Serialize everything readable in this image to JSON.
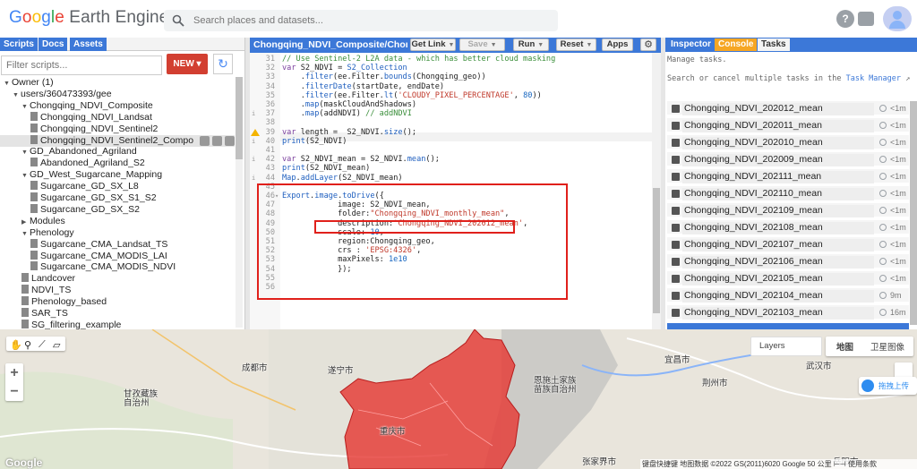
{
  "header": {
    "logo_google": [
      "G",
      "o",
      "o",
      "g",
      "l",
      "e"
    ],
    "logo_product": "Earth Engine",
    "search_placeholder": "Search places and datasets...",
    "help_icon": "?"
  },
  "left_panel": {
    "tabs": [
      "Scripts",
      "Docs",
      "Assets"
    ],
    "filter_placeholder": "Filter scripts...",
    "new_label": "NEW",
    "tree": [
      {
        "label": "Owner (1)",
        "level": 0,
        "type": "folder",
        "open": true
      },
      {
        "label": "users/360473393/gee",
        "level": 1,
        "type": "folder",
        "open": true
      },
      {
        "label": "Chongqing_NDVI_Composite",
        "level": 2,
        "type": "folder",
        "open": true
      },
      {
        "label": "Chongqing_NDVI_Landsat",
        "level": 3,
        "type": "file"
      },
      {
        "label": "Chongqing_NDVI_Sentinel2",
        "level": 3,
        "type": "file"
      },
      {
        "label": "Chongqing_NDVI_Sentinel2_Compo",
        "level": 3,
        "type": "file",
        "selected": true
      },
      {
        "label": "GD_Abandoned_Agriland",
        "level": 2,
        "type": "folder",
        "open": true
      },
      {
        "label": "Abandoned_Agriland_S2",
        "level": 3,
        "type": "file"
      },
      {
        "label": "GD_West_Sugarcane_Mapping",
        "level": 2,
        "type": "folder",
        "open": true
      },
      {
        "label": "Sugarcane_GD_SX_L8",
        "level": 3,
        "type": "file"
      },
      {
        "label": "Sugarcane_GD_SX_S1_S2",
        "level": 3,
        "type": "file"
      },
      {
        "label": "Sugarcane_GD_SX_S2",
        "level": 3,
        "type": "file"
      },
      {
        "label": "Modules",
        "level": 2,
        "type": "folder",
        "open": false
      },
      {
        "label": "Phenology",
        "level": 2,
        "type": "folder",
        "open": true
      },
      {
        "label": "Sugarcane_CMA_Landsat_TS",
        "level": 3,
        "type": "file"
      },
      {
        "label": "Sugarcane_CMA_MODIS_LAI",
        "level": 3,
        "type": "file"
      },
      {
        "label": "Sugarcane_CMA_MODIS_NDVI",
        "level": 3,
        "type": "file"
      },
      {
        "label": "Landcover",
        "level": 2,
        "type": "file"
      },
      {
        "label": "NDVI_TS",
        "level": 2,
        "type": "file"
      },
      {
        "label": "Phenology_based",
        "level": 2,
        "type": "file"
      },
      {
        "label": "SAR_TS",
        "level": 2,
        "type": "file"
      },
      {
        "label": "SG_filtering_example",
        "level": 2,
        "type": "file"
      }
    ]
  },
  "editor": {
    "title": "Chongqing_NDVI_Composite/Chongqi...",
    "buttons": {
      "get_link": "Get Link",
      "save": "Save",
      "run": "Run",
      "reset": "Reset",
      "apps": "Apps"
    },
    "lines": [
      {
        "n": "31",
        "html": "<span class=\"cmt\">// Use Sentinel-2 L2A data - which has better cloud masking</span>"
      },
      {
        "n": "32",
        "html": "<span class=\"kw\">var</span> S2_NDVI = <span class=\"fn\">S2_Collection</span>"
      },
      {
        "n": "33",
        "html": "    .<span class=\"fn\">filter</span>(ee.Filter.<span class=\"fn\">bounds</span>(Chongqing_geo))"
      },
      {
        "n": "34",
        "html": "    .<span class=\"fn\">filterDate</span>(startDate, endDate)"
      },
      {
        "n": "35",
        "html": "    .<span class=\"fn\">filter</span>(ee.Filter.<span class=\"fn\">lt</span>(<span class=\"str\">'CLOUDY_PIXEL_PERCENTAGE'</span>, <span class=\"num\">80</span>))"
      },
      {
        "n": "36",
        "html": "    .<span class=\"fn\">map</span>(maskCloudAndShadows)"
      },
      {
        "n": "37",
        "html": "    .<span class=\"fn\">map</span>(addNDVI) <span class=\"cmt\">// addNDVI</span>"
      },
      {
        "n": "38",
        "html": ""
      },
      {
        "n": "39",
        "html": "<span class=\"kw\">var</span> length =  S2_NDVI.<span class=\"fn\">size</span>();"
      },
      {
        "n": "40",
        "html": "<span class=\"fn\">print</span>(S2_NDVI)"
      },
      {
        "n": "41",
        "html": ""
      },
      {
        "n": "42",
        "html": "<span class=\"kw\">var</span> S2_NDVI_mean = S2_NDVI.<span class=\"fn\">mean</span>();"
      },
      {
        "n": "43",
        "html": "<span class=\"fn\">print</span>(S2_NDVI_mean)"
      },
      {
        "n": "44",
        "html": "<span class=\"fn\">Map</span>.<span class=\"fn\">addLayer</span>(S2_NDVI_mean)"
      },
      {
        "n": "45",
        "html": ""
      },
      {
        "n": "46",
        "html": "<span class=\"fn\">Export</span>.<span class=\"fn\">image</span>.<span class=\"fn\">toDrive</span>({"
      },
      {
        "n": "47",
        "html": "            image: S2_NDVI_mean,"
      },
      {
        "n": "48",
        "html": "            folder:<span class=\"str\">\"Chongqing_NDVI_monthly_mean\"</span>,"
      },
      {
        "n": "49",
        "html": "            description:<span class=\"str\">'Chongqing_NDVI_202012_mean'</span>,"
      },
      {
        "n": "50",
        "html": "            scale: <span class=\"num\">10</span>,"
      },
      {
        "n": "51",
        "html": "            region:Chongqing_geo,"
      },
      {
        "n": "52",
        "html": "            crs : <span class=\"str\">'EPSG:4326'</span>,"
      },
      {
        "n": "53",
        "html": "            maxPixels: <span class=\"num\">1e10</span>"
      },
      {
        "n": "54",
        "html": "            });"
      },
      {
        "n": "55",
        "html": ""
      },
      {
        "n": "56",
        "html": ""
      }
    ]
  },
  "right_panel": {
    "tabs": [
      "Inspector",
      "Console",
      "Tasks"
    ],
    "manage_text": "Manage tasks.",
    "search_text": "Search or cancel multiple tasks in the",
    "task_manager_link": "Task Manager",
    "tasks": [
      {
        "name": "Chongqing_NDVI_202012_mean",
        "time": "<1m"
      },
      {
        "name": "Chongqing_NDVI_202011_mean",
        "time": "<1m"
      },
      {
        "name": "Chongqing_NDVI_202010_mean",
        "time": "<1m"
      },
      {
        "name": "Chongqing_NDVI_202009_mean",
        "time": "<1m"
      },
      {
        "name": "Chongqing_NDVI_202111_mean",
        "time": "<1m"
      },
      {
        "name": "Chongqing_NDVI_202110_mean",
        "time": "<1m"
      },
      {
        "name": "Chongqing_NDVI_202109_mean",
        "time": "<1m"
      },
      {
        "name": "Chongqing_NDVI_202108_mean",
        "time": "<1m"
      },
      {
        "name": "Chongqing_NDVI_202107_mean",
        "time": "<1m"
      },
      {
        "name": "Chongqing_NDVI_202106_mean",
        "time": "<1m"
      },
      {
        "name": "Chongqing_NDVI_202105_mean",
        "time": "<1m"
      },
      {
        "name": "Chongqing_NDVI_202104_mean",
        "time": "9m"
      },
      {
        "name": "Chongqing_NDVI_202103_mean",
        "time": "16m"
      }
    ]
  },
  "map": {
    "layers_label": "Layers",
    "map_type": "地图",
    "satellite_type": "卫星图像",
    "side_label": "拖拽上传",
    "google_logo": "Google",
    "attribution": "键盘快捷键   地图数据 ©2022 GS(2011)6020 Google   50 公里 ⊢⊣   使用条款",
    "cities": [
      {
        "label": "成都市"
      },
      {
        "label": "遂宁市"
      },
      {
        "label": "重庆市"
      },
      {
        "label": "宜昌市"
      },
      {
        "label": "武汉市"
      },
      {
        "label": "荆州市"
      },
      {
        "label": "甘孜藏族"
      },
      {
        "label": "自治州"
      },
      {
        "label": "恩施土家族"
      },
      {
        "label": "苗族自治州"
      },
      {
        "label": "张家界市"
      },
      {
        "label": "岳阳市"
      }
    ]
  }
}
